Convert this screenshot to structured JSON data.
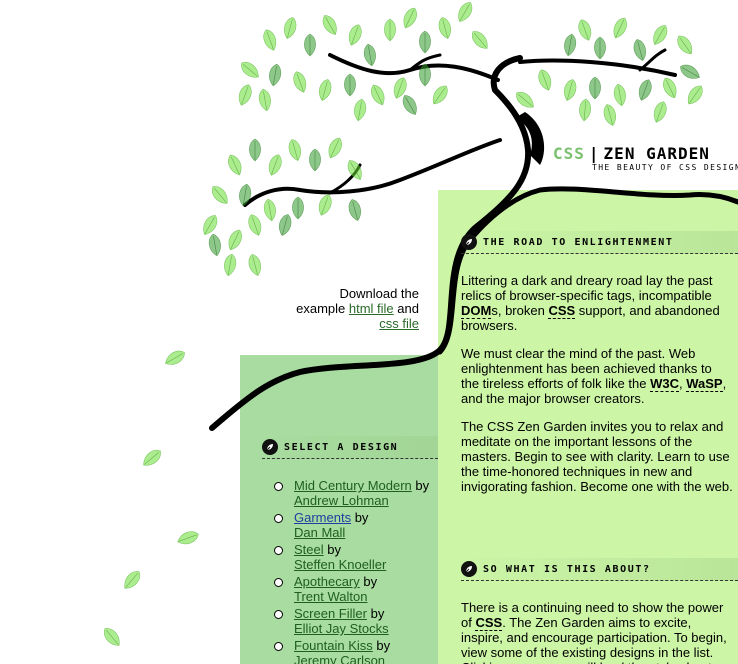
{
  "header": {
    "title_css": "CSS",
    "title_sep": "|",
    "title_rest": "ZEN GARDEN",
    "tagline": "THE BEAUTY OF CSS DESIGN"
  },
  "download": {
    "line1": "Download the",
    "line2_prefix": "example",
    "html_link": "html file",
    "line2_suffix": "and",
    "css_link": "css file"
  },
  "sections": {
    "road": {
      "heading": "THE ROAD TO ENLIGHTENMENT",
      "p1_a": "Littering a dark and dreary road lay the past relics of browser-specific tags, incompatible ",
      "p1_dom": "DOM",
      "p1_b": "s, broken ",
      "p1_css": "CSS",
      "p1_c": " support, and abandoned browsers.",
      "p2_a": "We must clear the mind of the past. Web enlightenment has been achieved thanks to the tireless efforts of folk like the ",
      "p2_w3c": "W3C",
      "p2_sep": ", ",
      "p2_wasp": "WaSP",
      "p2_b": ", and the major browser creators.",
      "p3": "The CSS Zen Garden invites you to relax and meditate on the important lessons of the masters. Begin to see with clarity. Learn to use the time-honored techniques in new and invigorating fashion. Become one with the web."
    },
    "about": {
      "heading": "SO WHAT IS THIS ABOUT?",
      "p1_a": "There is a continuing need to show the power of ",
      "p1_css": "CSS",
      "p1_b": ". The Zen Garden aims to excite, inspire, and encourage participation. To begin, view some of the existing designs in the list. Clicking on any one will load the style sheet"
    },
    "select": {
      "heading": "SELECT A DESIGN",
      "by": "by",
      "designs": [
        {
          "name": "Mid Century Modern",
          "author": "Andrew Lohman"
        },
        {
          "name": "Garments",
          "author": "Dan Mall"
        },
        {
          "name": "Steel",
          "author": "Steffen Knoeller"
        },
        {
          "name": "Apothecary",
          "author": "Trent Walton"
        },
        {
          "name": "Screen Filler",
          "author": "Elliot Jay Stocks"
        },
        {
          "name": "Fountain Kiss",
          "author": "Jeremy Carlson"
        }
      ]
    }
  },
  "colors": {
    "main_panel": "#ccf5a6",
    "side_panel": "#a8dca0",
    "leaf": "#66cc33",
    "accent": "#7ac06e"
  }
}
